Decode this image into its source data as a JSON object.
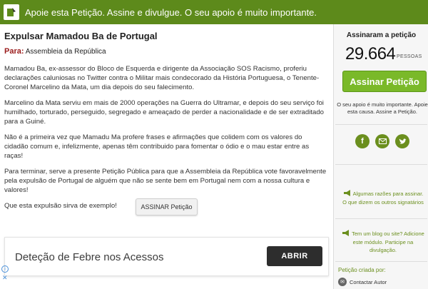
{
  "banner": {
    "text": "Apoie esta Petição. Assine e divulgue. O seu apoio é muito importante."
  },
  "petition": {
    "title": "Expulsar Mamadou Ba de Portugal",
    "to_label": "Para:",
    "to_value": "Assembleia da República",
    "paragraphs": [
      "Mamadou Ba, ex-assessor do Bloco de Esquerda e dirigente da Associação SOS Racismo, proferiu declarações caluniosas no Twitter contra o Militar mais condecorado da História Portuguesa, o Tenente-Coronel Marcelino da Mata, um dia depois do seu falecimento.",
      "Marcelino da Mata serviu em mais de 2000 operações na Guerra do Ultramar, e depois do seu serviço foi humilhado, torturado, perseguido, segregado e ameaçado de perder a nacionalidade e de ser extraditado para a Guiné.",
      "Não é a primeira vez que Mamadu Ma profere frases e afirmações que colidem com os valores do cidadão comum e, infelizmente, apenas têm contribuido para fomentar o ódio e o mau estar entre as raças!",
      "Para terminar, serve a presente Petição Pública para que a Assembleia da República vote favoravelmente pela expulsão de Portugal de alguém que não se sente bem em Portugal nem com a nossa cultura e valores!",
      "Que esta expulsão sirva de exemplo!"
    ],
    "sign_button": "ASSINAR Petição"
  },
  "ad": {
    "text": "Deteção de Febre nos Acessos",
    "button": "ABRIR"
  },
  "sidebar": {
    "signed_label": "Assinaram a petição",
    "count": "29.664",
    "count_unit": "PESSOAS",
    "sign_button": "Assinar Petição",
    "support_text": "O seu apoio é muito importante. Apoie esta causa. Assine a Petição.",
    "reasons_link": "Algumas razões para assinar.",
    "others_link": "O que dizem os outros signatários",
    "blog_text": "Tem um blog ou site? Adicione este módulo. Participe na divulgação.",
    "created_by": "Petição criada por:",
    "contact": "Contactar Autor"
  },
  "colors": {
    "banner": "#5d8a1b",
    "accent_green": "#7ab929",
    "link_green": "#6b8f1e",
    "to_label": "#9a1b1b"
  },
  "icons": {
    "banner": "petition-logo-icon",
    "facebook": "facebook-icon",
    "email": "email-icon",
    "twitter": "twitter-icon",
    "reasons": "megaphone-icon",
    "blog": "megaphone-icon",
    "contact": "envelope-icon"
  }
}
